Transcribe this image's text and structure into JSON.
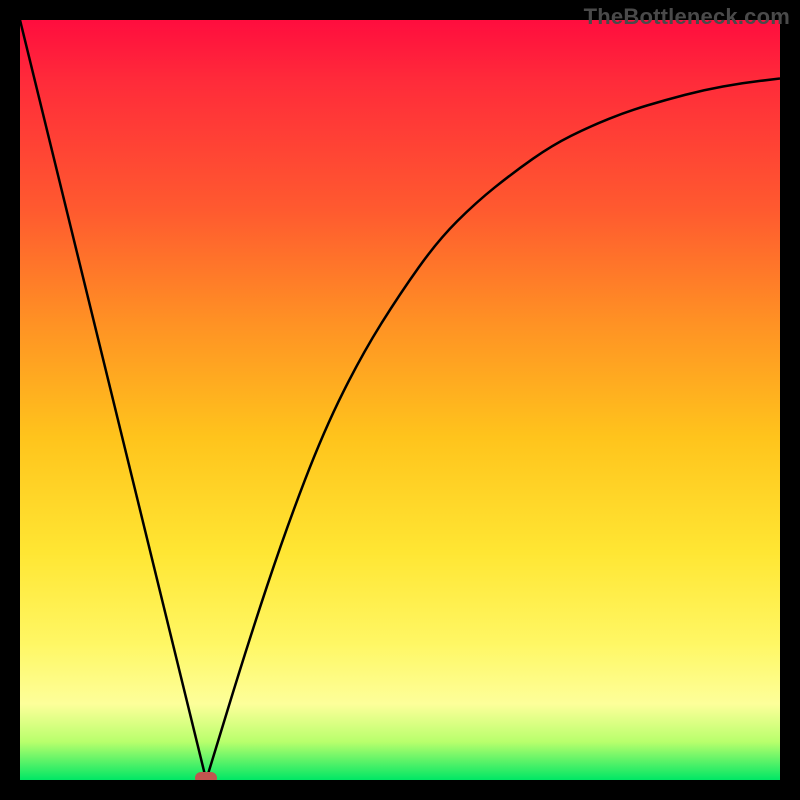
{
  "watermark_text": "TheBottleneck.com",
  "chart_data": {
    "type": "line",
    "title": "",
    "xlabel": "",
    "ylabel": "",
    "xlim": [
      0,
      100
    ],
    "ylim": [
      0,
      100
    ],
    "grid": false,
    "legend": false,
    "background_gradient": {
      "orientation": "vertical",
      "stops": [
        {
          "pos": 0.0,
          "color": "#ff0d3e"
        },
        {
          "pos": 0.25,
          "color": "#ff5a2f"
        },
        {
          "pos": 0.5,
          "color": "#ffc41c"
        },
        {
          "pos": 0.8,
          "color": "#fff764"
        },
        {
          "pos": 1.0,
          "color": "#00e765"
        }
      ]
    },
    "series": [
      {
        "name": "left-falling-line",
        "x": [
          0,
          24.5
        ],
        "y": [
          100,
          0
        ]
      },
      {
        "name": "right-rising-curve",
        "x": [
          24.5,
          30,
          35,
          40,
          45,
          50,
          55,
          60,
          65,
          70,
          75,
          80,
          85,
          90,
          95,
          100
        ],
        "y": [
          0,
          18,
          33,
          46,
          56,
          64,
          71,
          76,
          80,
          83.5,
          86,
          88,
          89.5,
          90.8,
          91.7,
          92.3
        ]
      }
    ],
    "marker": {
      "name": "dip-marker",
      "x": 24.5,
      "y": 0,
      "color": "#c0554f",
      "shape": "rounded-rect"
    }
  },
  "colors": {
    "frame_border": "#000000",
    "curve_stroke": "#000000",
    "watermark": "#4a4a4a"
  }
}
